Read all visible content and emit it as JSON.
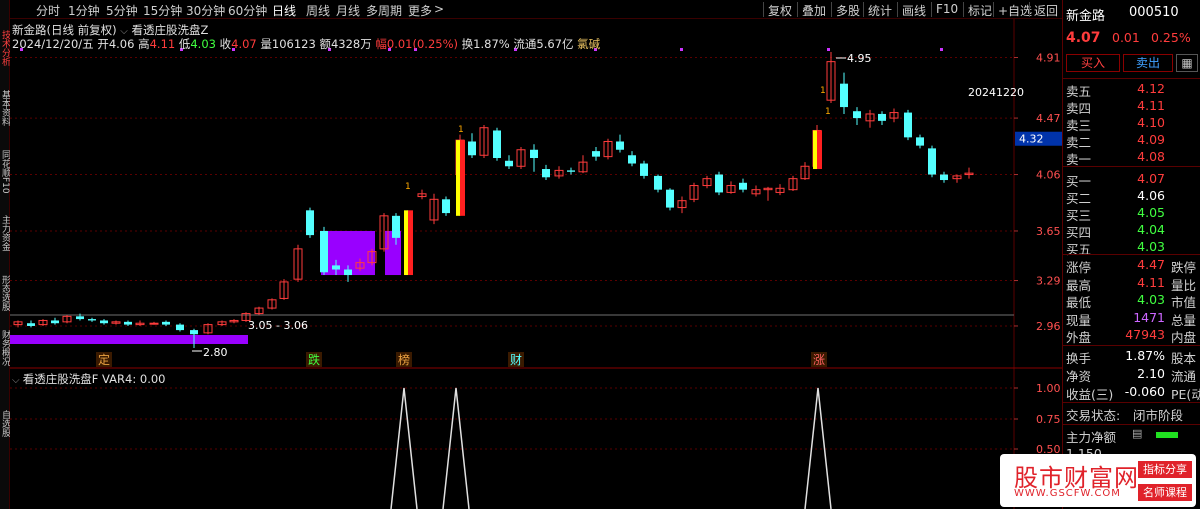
{
  "colors": {
    "up": "#ff3c3c",
    "down": "#54ffff",
    "purple": "#9900ff",
    "grid": "#5a0000",
    "yellow": "#ffff00"
  },
  "side_tabs": [
    "技术分析",
    "基本资料",
    "同花顺F10",
    "主力资金",
    "形态选股",
    "财务概况",
    "自选股"
  ],
  "toolbar": {
    "periods": [
      "分时",
      "1分钟",
      "5分钟",
      "15分钟",
      "30分钟",
      "60分钟",
      "日线",
      "周线",
      "月线",
      "多周期",
      "更多"
    ],
    "more_arrow": ">",
    "actions": [
      "复权",
      "叠加",
      "多股",
      "统计",
      "画线",
      "F10",
      "标记",
      "+自选",
      "返回"
    ]
  },
  "chart": {
    "header": {
      "name": "新金路(日线 前复权)",
      "indicator": "看透庄股洗盘Z",
      "date": "2024/12/20/五",
      "open_label": "开",
      "open": "4.06",
      "high_label": "高",
      "high": "4.11",
      "low_label": "低",
      "low": "4.03",
      "close_label": "收",
      "close": "4.07",
      "vol_label": "量",
      "vol": "106123",
      "amount_label": "额",
      "amount": "4328万",
      "change_label": "幅",
      "change": "0.01(0.25%)",
      "turnover_label": "换",
      "turnover": "1.87%",
      "float_label": "流通",
      "float_val": "5.67亿",
      "status": "氯碱"
    },
    "date_label": "20241220",
    "y_axis": [
      "4.91",
      "4.47",
      "4.06",
      "3.65",
      "3.29",
      "2.96"
    ],
    "price_tag": "4.32",
    "annotations": {
      "high_mark": "4.95",
      "low_mark": "2.80",
      "range_label": "3.05 - 3.06"
    },
    "event_labels": [
      {
        "text": "定",
        "color": "#e8a040"
      },
      {
        "text": "跌",
        "color": "#40ff40"
      },
      {
        "text": "榜",
        "color": "#e8a040"
      },
      {
        "text": "财",
        "color": "#54ffff"
      },
      {
        "text": "涨",
        "color": "#ff6060"
      }
    ],
    "signal_marks": [
      "1",
      "1",
      "1",
      "1"
    ]
  },
  "sub_chart": {
    "name": "看透庄股洗盘F",
    "var_label": "VAR4:",
    "var_value": "0.00",
    "y_axis": [
      "1.00",
      "0.75",
      "0.50"
    ]
  },
  "quote_panel": {
    "name": "新金路",
    "code": "000510",
    "price": "4.07",
    "change": "0.01",
    "change_pct": "0.25%",
    "buttons": {
      "buy": "买入",
      "sell": "卖出"
    },
    "sells": [
      {
        "label": "卖五",
        "price": "4.12"
      },
      {
        "label": "卖四",
        "price": "4.11"
      },
      {
        "label": "卖三",
        "price": "4.10"
      },
      {
        "label": "卖二",
        "price": "4.09"
      },
      {
        "label": "卖一",
        "price": "4.08"
      }
    ],
    "buys": [
      {
        "label": "买一",
        "price": "4.07"
      },
      {
        "label": "买二",
        "price": "4.06"
      },
      {
        "label": "买三",
        "price": "4.05"
      },
      {
        "label": "买四",
        "price": "4.04"
      },
      {
        "label": "买五",
        "price": "4.03"
      }
    ],
    "stats": [
      {
        "label": "涨停",
        "value": "4.47",
        "extra": "跌停",
        "color": "#ff3c3c"
      },
      {
        "label": "最高",
        "value": "4.11",
        "extra": "量比",
        "color": "#ff3c3c"
      },
      {
        "label": "最低",
        "value": "4.03",
        "extra": "市值",
        "color": "#40ff40"
      },
      {
        "label": "现量",
        "value": "1471",
        "extra": "总量",
        "color": "#cc66ff"
      },
      {
        "label": "外盘",
        "value": "47943",
        "extra": "内盘",
        "color": "#ff3c3c"
      }
    ],
    "stats2": [
      {
        "label": "换手",
        "value": "1.87%",
        "extra": "股本"
      },
      {
        "label": "净资",
        "value": "2.10",
        "extra": "流通"
      },
      {
        "label": "收益(三)",
        "value": "-0.060",
        "extra": "PE(动"
      }
    ],
    "trade_status_label": "交易状态:",
    "trade_status": "闭市阶段",
    "main_flow_label": "主力净额",
    "bottom_row": "1.150"
  },
  "watermark": {
    "title": "股市财富网",
    "url": "WWW.GSCFW.COM",
    "tag1": "指标分享",
    "tag2": "名师课程"
  }
}
